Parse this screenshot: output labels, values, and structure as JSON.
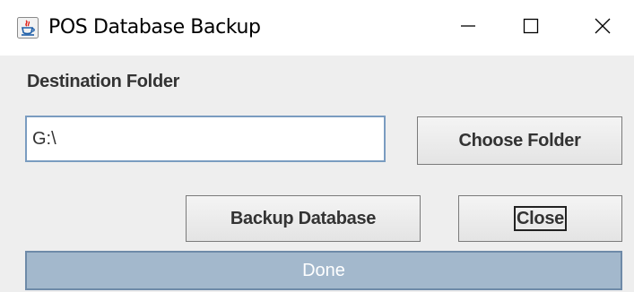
{
  "window": {
    "title": "POS Database Backup",
    "icon": "java-app-icon",
    "controls": {
      "minimize_icon": "minimize-icon",
      "maximize_icon": "maximize-icon",
      "close_icon": "close-icon"
    }
  },
  "form": {
    "destination_label": "Destination Folder",
    "path_value": "G:\\",
    "choose_folder_label": "Choose Folder",
    "backup_label": "Backup Database",
    "close_label": "Close"
  },
  "progress": {
    "text": "Done",
    "percent": 100
  },
  "colors": {
    "window_bg": "#eeeeee",
    "titlebar_bg": "#ffffff",
    "progress_fill": "#a3b8cc",
    "input_border": "#7a9cc0"
  }
}
